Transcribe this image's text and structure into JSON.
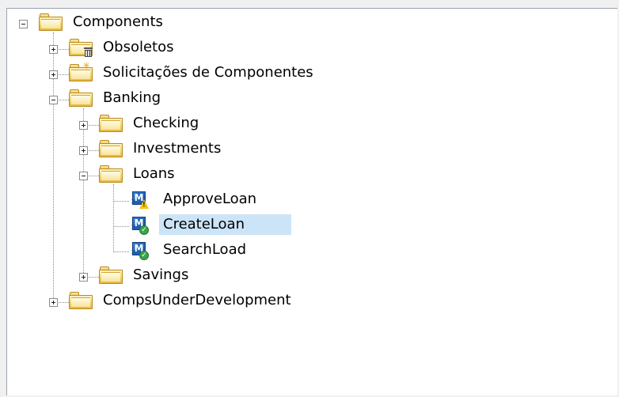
{
  "tree": {
    "root": {
      "label": "Components"
    },
    "obsoletos": {
      "label": "Obsoletos"
    },
    "solicitacoes": {
      "label": "Solicitações de Componentes"
    },
    "banking": {
      "label": "Banking"
    },
    "checking": {
      "label": "Checking"
    },
    "investments": {
      "label": "Investments"
    },
    "loans": {
      "label": "Loans"
    },
    "approve_loan": {
      "label": "ApproveLoan",
      "status": "warning"
    },
    "create_loan": {
      "label": "CreateLoan",
      "status": "ok",
      "selected": true
    },
    "search_load": {
      "label": "SearchLoad",
      "status": "ok"
    },
    "savings": {
      "label": "Savings"
    },
    "comps_under_development": {
      "label": "CompsUnderDevelopment"
    }
  },
  "colors": {
    "selection": "#cce4f7",
    "folder": "#f6d97a",
    "component": "#2c7ed6",
    "ok_badge": "#3aa64a",
    "warning_badge": "#f4c20d"
  },
  "icons": {
    "folder": "folder-icon",
    "component": "component-icon",
    "trash": "trash-icon",
    "new": "spark-icon"
  }
}
